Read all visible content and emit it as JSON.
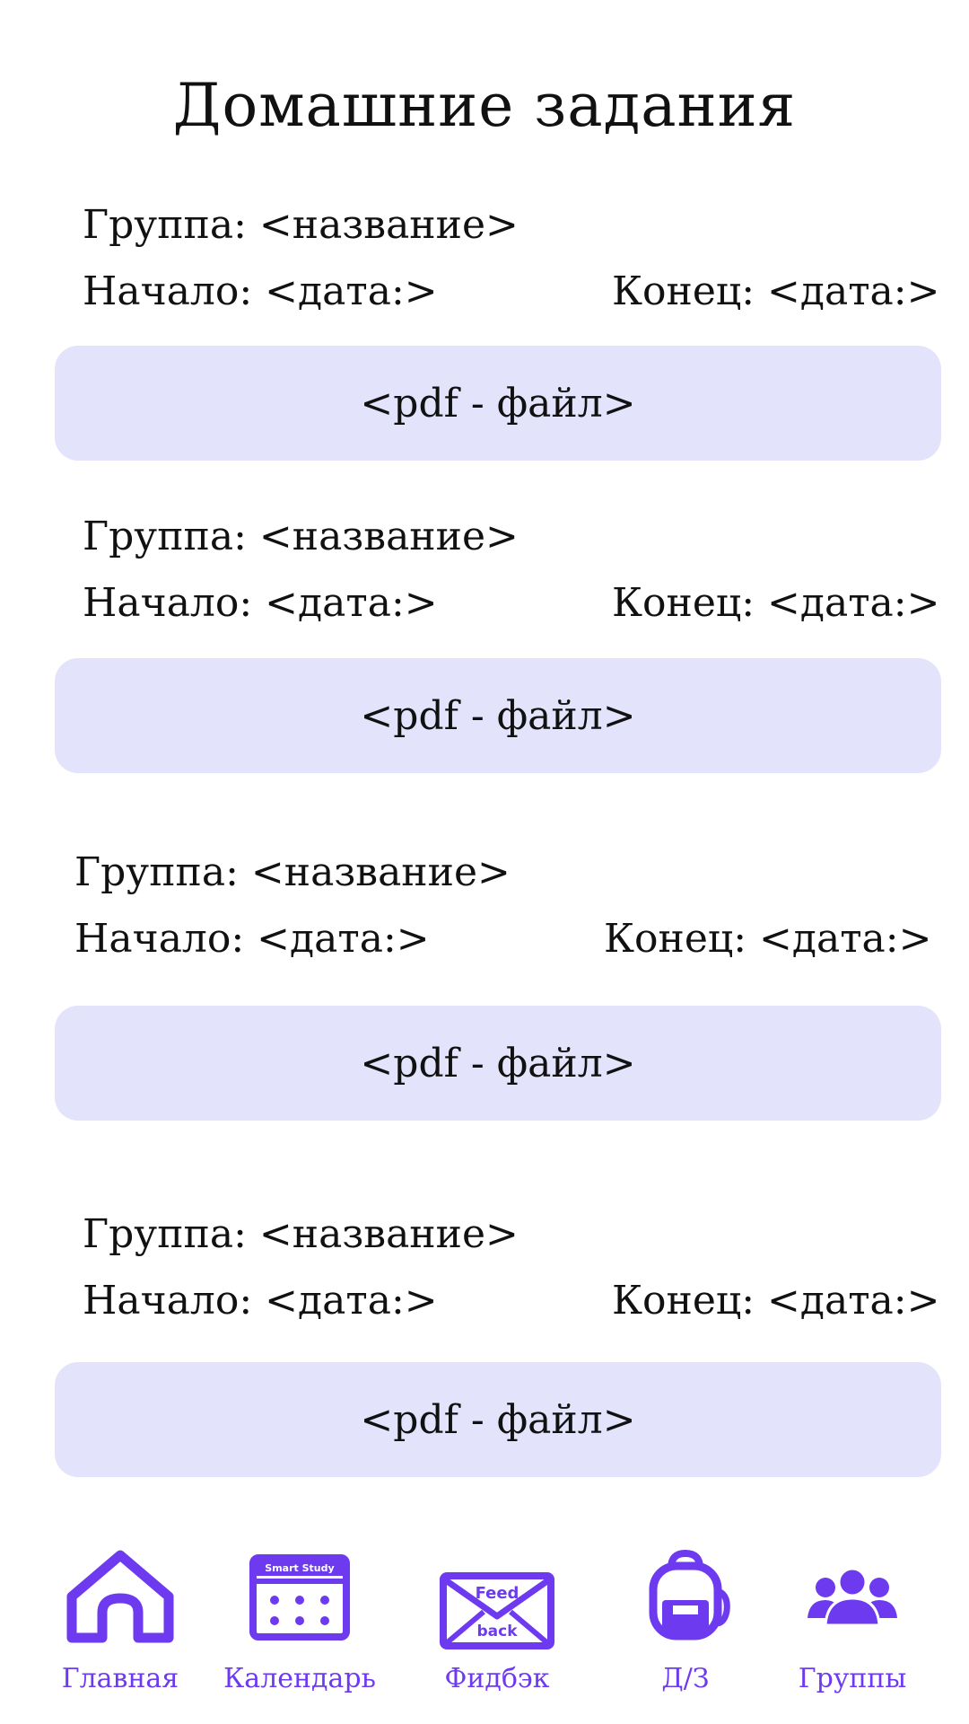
{
  "page": {
    "title": "Домашние задания"
  },
  "colors": {
    "accent": "#6D3AF0",
    "card_bg": "#E3E3FC",
    "text": "#111111"
  },
  "homework": [
    {
      "group": "Группа: <название>",
      "start": "Начало: <дата:>",
      "end": "Конец: <дата:>",
      "file": "<pdf - файл>"
    },
    {
      "group": "Группа: <название>",
      "start": "Начало: <дата:>",
      "end": "Конец: <дата:>",
      "file": "<pdf - файл>"
    },
    {
      "group": "Группа: <название>",
      "start": "Начало: <дата:>",
      "end": "Конец: <дата:>",
      "file": "<pdf - файл>"
    },
    {
      "group": "Группа: <название>",
      "start": "Начало: <дата:>",
      "end": "Конец: <дата:>",
      "file": "<pdf - файл>"
    }
  ],
  "nav": {
    "items": [
      {
        "label": "Главная",
        "icon": "home-icon"
      },
      {
        "label": "Календарь",
        "icon": "calendar-icon",
        "icon_text": "Smart Study"
      },
      {
        "label": "Фидбэк",
        "icon": "feedback-envelope-icon",
        "icon_text_top": "Feed",
        "icon_text_bottom": "back"
      },
      {
        "label": "Д/З",
        "icon": "backpack-icon"
      },
      {
        "label": "Группы",
        "icon": "users-icon"
      }
    ]
  }
}
